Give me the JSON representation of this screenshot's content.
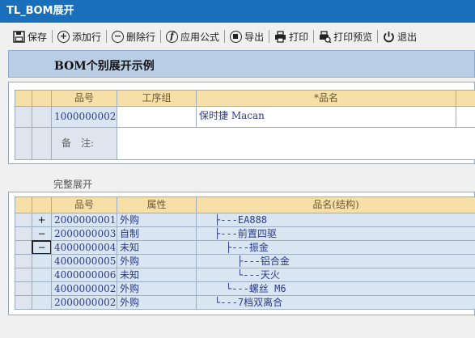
{
  "window": {
    "title": "TL_BOM展开"
  },
  "toolbar": {
    "save": "保存",
    "add_row": "添加行",
    "delete_row": "删除行",
    "apply_formula": "应用公式",
    "export": "导出",
    "print": "打印",
    "print_preview": "打印预览",
    "exit": "退出"
  },
  "header": {
    "title": "BOM个别展开示例"
  },
  "top_table": {
    "headers": {
      "item_no": "品号",
      "process_group": "工序组",
      "item_name": "*品名"
    },
    "row": {
      "item_no": "1000000002",
      "process_group": "",
      "item_name": "保时捷 Macan"
    },
    "remark_label": "备　注:",
    "remark_value": ""
  },
  "section": {
    "label": "完整展开"
  },
  "bom_table": {
    "headers": {
      "item_no": "品号",
      "attribute": "属性",
      "structure": "品名(结构)"
    },
    "rows": [
      {
        "toggle": "+",
        "item_no": "2000000001",
        "attribute": "外购",
        "structure": "├---EA888"
      },
      {
        "toggle": "−",
        "item_no": "2000000003",
        "attribute": "自制",
        "structure": "├---前置四驱"
      },
      {
        "toggle": "−",
        "item_no": "4000000004",
        "attribute": "未知",
        "structure": "├---振金"
      },
      {
        "toggle": "",
        "item_no": "4000000005",
        "attribute": "外购",
        "structure": "├---铝合金"
      },
      {
        "toggle": "",
        "item_no": "4000000006",
        "attribute": "未知",
        "structure": "└---天火"
      },
      {
        "toggle": "",
        "item_no": "4000000002",
        "attribute": "外购",
        "structure": "└---螺丝 M6"
      },
      {
        "toggle": "",
        "item_no": "2000000002",
        "attribute": "外购",
        "structure": "└---7档双离合"
      }
    ]
  }
}
